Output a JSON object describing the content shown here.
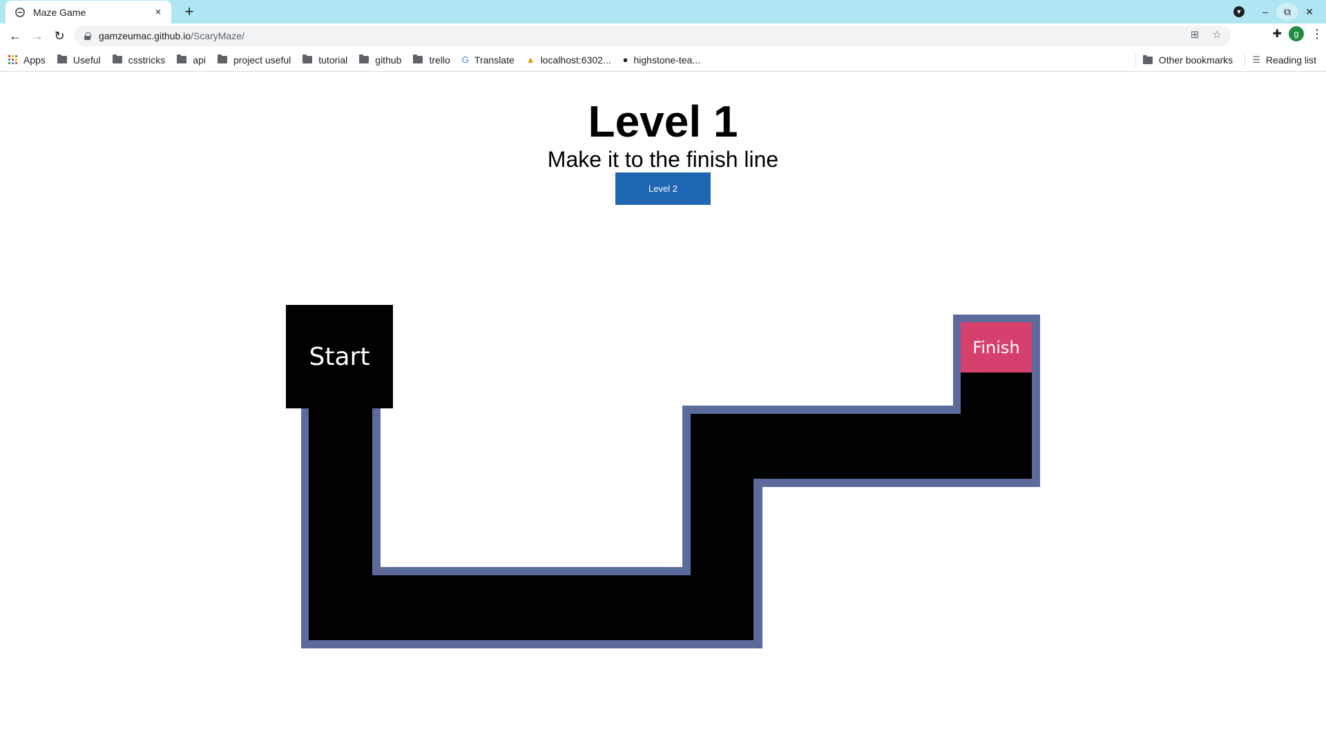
{
  "browser": {
    "tab": {
      "title": "Maze Game",
      "favicon": "globe-icon",
      "close": "×"
    },
    "new_tab": "+",
    "window_controls": {
      "minimize": "–",
      "restore": "⧉",
      "close": "✕"
    },
    "url": {
      "host": "gamzeumac.github.io",
      "path": "/ScaryMaze/"
    },
    "profile_initial": "g",
    "bookmarks": [
      {
        "label": "Apps",
        "icon": "apps-icon"
      },
      {
        "label": "Useful",
        "icon": "folder-icon"
      },
      {
        "label": "csstricks",
        "icon": "folder-icon"
      },
      {
        "label": "api",
        "icon": "folder-icon"
      },
      {
        "label": "project useful",
        "icon": "folder-icon"
      },
      {
        "label": "tutorial",
        "icon": "folder-icon"
      },
      {
        "label": "github",
        "icon": "folder-icon"
      },
      {
        "label": "trello",
        "icon": "folder-icon"
      },
      {
        "label": "Translate",
        "icon": "translate-icon"
      },
      {
        "label": "localhost:6302...",
        "icon": "site-icon"
      },
      {
        "label": "highstone-tea...",
        "icon": "github-icon"
      }
    ],
    "other_bookmarks": "Other bookmarks",
    "reading_list": "Reading list"
  },
  "page": {
    "title": "Level 1",
    "subtitle": "Make it to the finish line",
    "next_level_button": "Level 2"
  },
  "maze": {
    "start_label": "Start",
    "finish_label": "Finish",
    "colors": {
      "path": "#000000",
      "wall": "#5d6b9c",
      "finish": "#d6406d",
      "button": "#1f66b3",
      "tabstrip": "#aee6f1"
    }
  }
}
